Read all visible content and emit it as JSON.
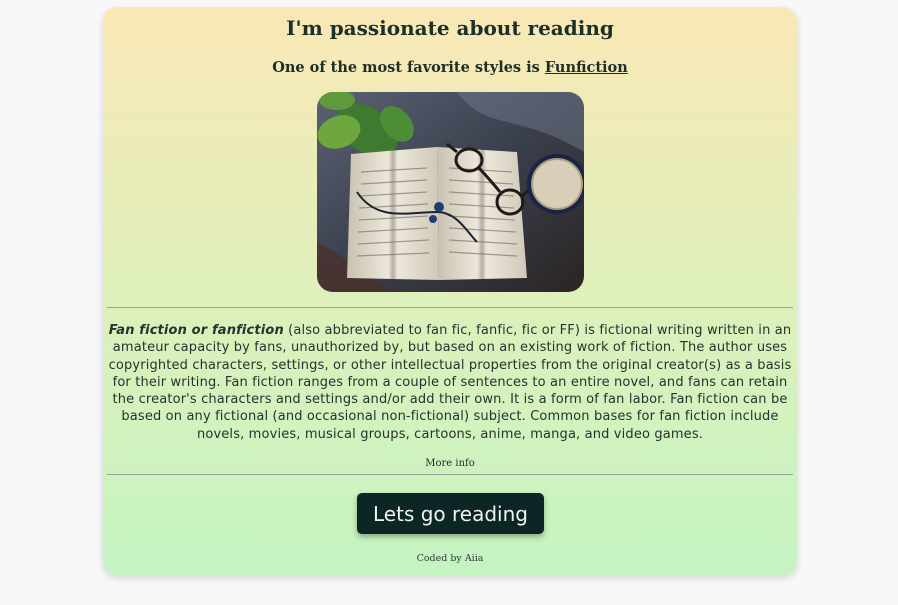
{
  "page": {
    "title": "I'm passionate about reading",
    "subtitle_prefix": "One of the most favorite styles is ",
    "subtitle_link": "Funfiction",
    "image_name": "open-book-with-glasses-and-coffee",
    "body_lead": "Fan fiction or fanfiction",
    "body_text": " (also abbreviated to fan fic, fanfic, fic or FF) is fictional writing written in an amateur capacity by fans, unauthorized by, but based on an existing work of fiction. The author uses copyrighted characters, settings, or other intellectual properties from the original creator(s) as a basis for their writing. Fan fiction ranges from a couple of sentences to an entire novel, and fans can retain the creator's characters and settings and/or add their own. It is a form of fan labor. Fan fiction can be based on any fictional (and occasional non-fictional) subject. Common bases for fan fiction include novels, movies, musical groups, cartoons, anime, manga, and video games.",
    "more_info": "More info",
    "cta_label": "Lets go reading",
    "credit": "Coded by Aiia"
  },
  "colors": {
    "gradient_top": "#f9e8b6",
    "gradient_bottom": "#c4f4c2",
    "button_bg": "#0c2525",
    "text": "#1e2e29"
  }
}
